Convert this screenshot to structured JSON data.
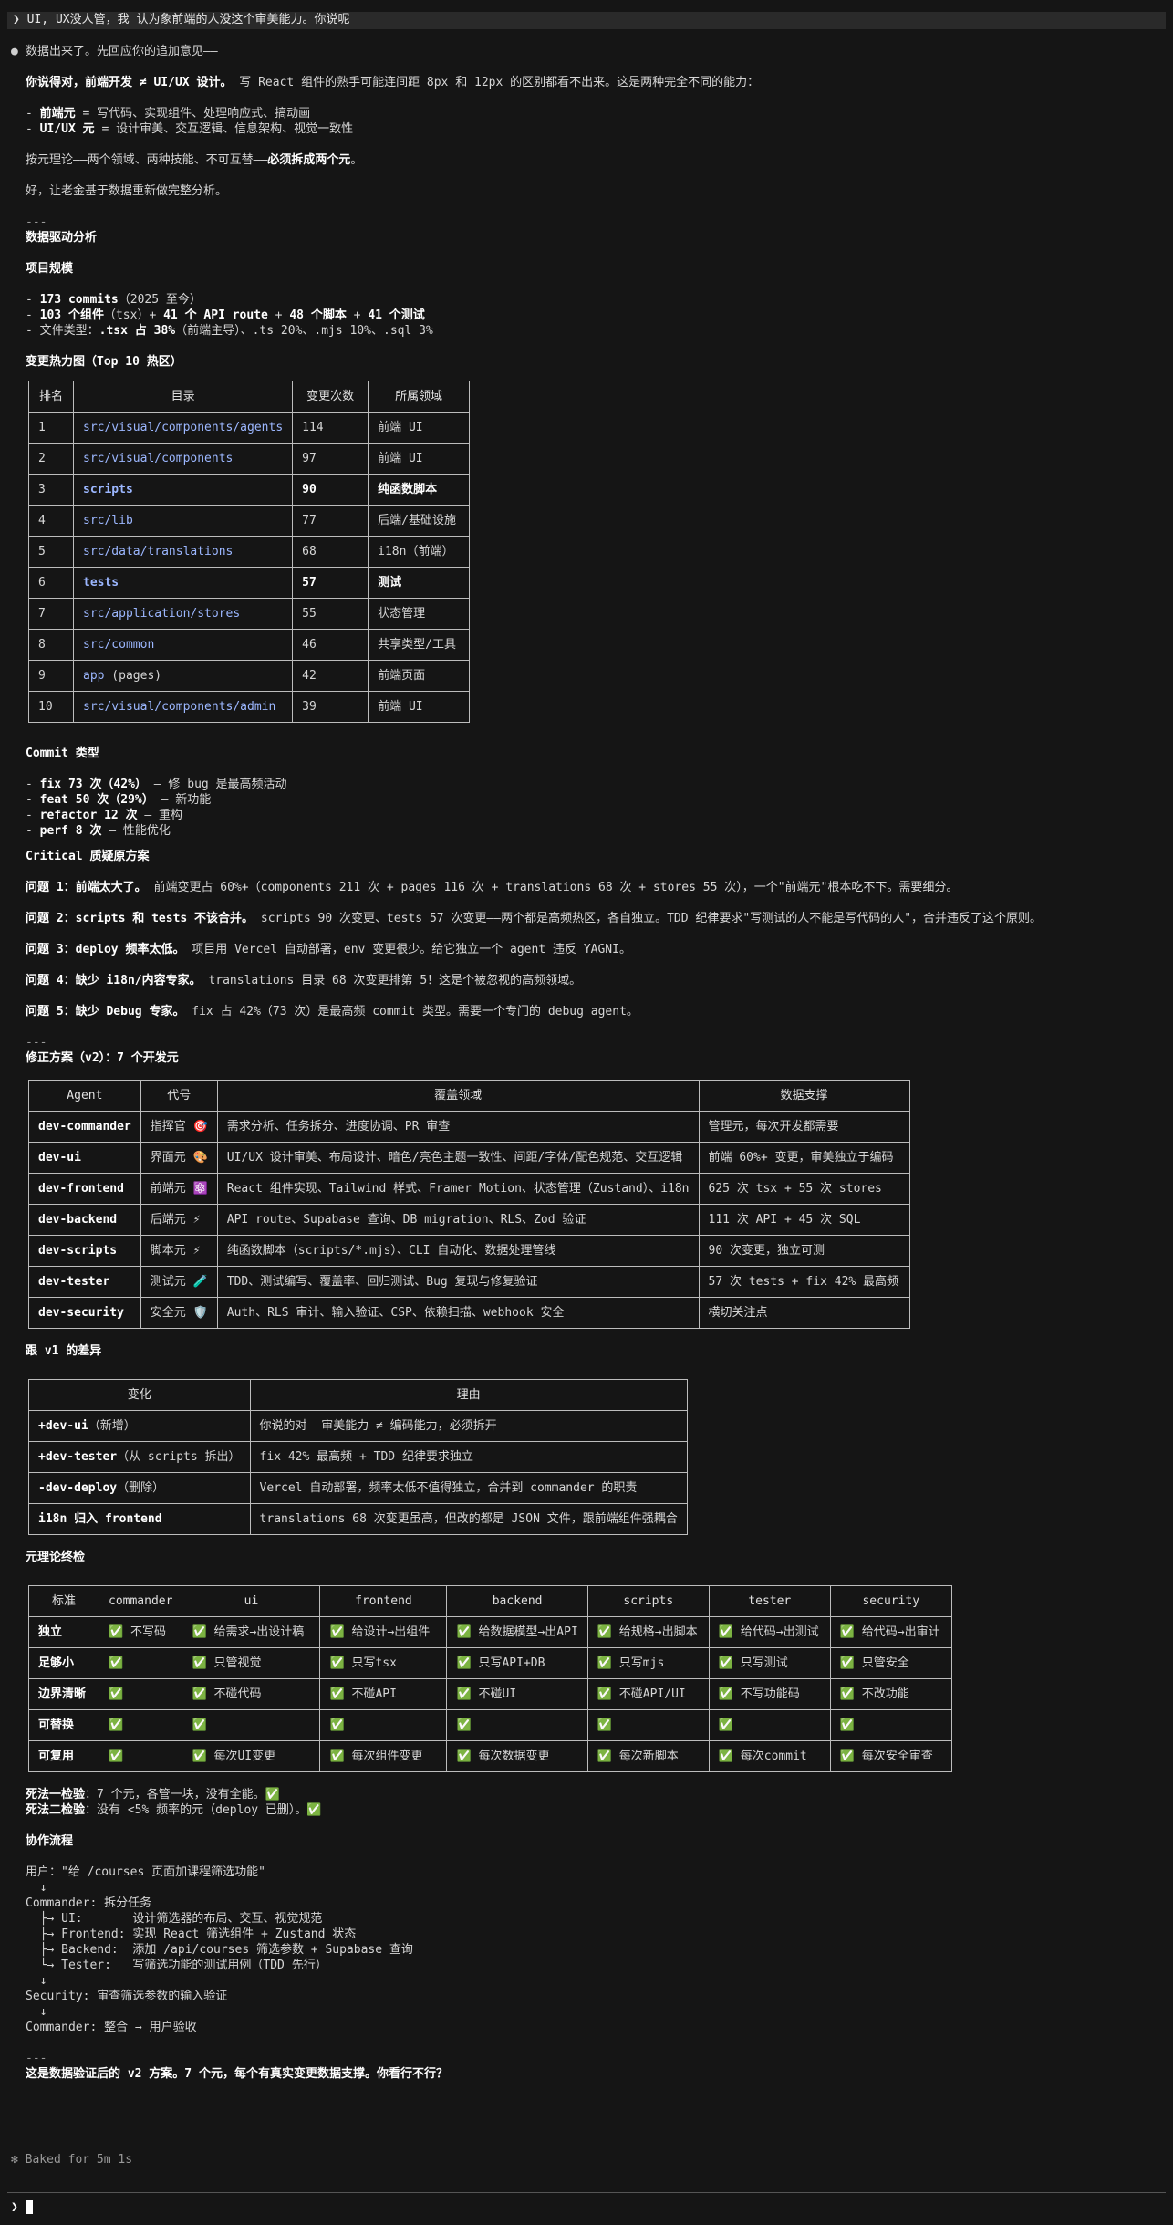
{
  "user_message": "UI, UX没人管，我 认为象前端的人没这个审美能力。你说呢",
  "response": {
    "intro": "数据出来了。先回应你的追加意见——",
    "claim_bold": "你说得对，前端开发 ≠ UI/UX 设计。",
    "claim_rest": "写 React 组件的熟手可能连间距 8px 和 12px 的区别都看不出来。这是两种完全不同的能力：",
    "roles": [
      {
        "name": "前端元",
        "desc": " = 写代码、实现组件、处理响应式、搞动画"
      },
      {
        "name": "UI/UX 元",
        "desc": " = 设计审美、交互逻辑、信息架构、视觉一致性"
      }
    ],
    "principle_a": "按元理论——两个领域、两种技能、不可互替——",
    "principle_b": "必须拆成两个元",
    "principle_c": "。",
    "transition": "好，让老金基于数据重新做完整分析。",
    "hr": "---",
    "section_data": "数据驱动分析",
    "section_scale": "项目规模",
    "scale": [
      {
        "pre": "- ",
        "b1": "173 commits",
        "post": "（2025 至今）"
      },
      {
        "pre": "- ",
        "b1": "103 个组件",
        "mid": "（tsx）+ ",
        "b2": "41 个 API route",
        "mid2": " + ",
        "b3": "48 个脚本",
        "mid3": " + ",
        "b4": "41 个测试"
      },
      {
        "pre": "- 文件类型：",
        "b1": ".tsx 占 38%",
        "post": "（前端主导）、.ts 20%、.mjs 10%、.sql 3%"
      }
    ],
    "heatmap_title": "变更热力图（Top 10 热区）",
    "heatmap_headers": [
      "排名",
      "目录",
      "变更次数",
      "所属领域"
    ],
    "heatmap_rows": [
      {
        "rank": "1",
        "dir": "src/visual/components/agents",
        "count": "114",
        "domain": "前端 UI",
        "bold": false
      },
      {
        "rank": "2",
        "dir": "src/visual/components",
        "count": "97",
        "domain": "前端 UI",
        "bold": false
      },
      {
        "rank": "3",
        "dir": "scripts",
        "count": "90",
        "domain": "纯函数脚本",
        "bold": true
      },
      {
        "rank": "4",
        "dir": "src/lib",
        "count": "77",
        "domain": "后端/基础设施",
        "bold": false
      },
      {
        "rank": "5",
        "dir": "src/data/translations",
        "count": "68",
        "domain": "i18n（前端）",
        "bold": false
      },
      {
        "rank": "6",
        "dir": "tests",
        "count": "57",
        "domain": "测试",
        "bold": true
      },
      {
        "rank": "7",
        "dir": "src/application/stores",
        "count": "55",
        "domain": "状态管理",
        "bold": false
      },
      {
        "rank": "8",
        "dir": "src/common",
        "count": "46",
        "domain": "共享类型/工具",
        "bold": false
      },
      {
        "rank": "9",
        "dir": "app",
        "dir_suffix": " (pages)",
        "count": "42",
        "domain": "前端页面",
        "bold": false
      },
      {
        "rank": "10",
        "dir": "src/visual/components/admin",
        "count": "39",
        "domain": "前端 UI",
        "bold": false
      }
    ],
    "commit_title": "Commit 类型",
    "commits": [
      {
        "b": "fix 73 次（42%）",
        "rest": " — 修 bug 是最高频活动"
      },
      {
        "b": "feat 50 次（29%）",
        "rest": " — 新功能"
      },
      {
        "b": "refactor 12 次",
        "rest": " — 重构"
      },
      {
        "b": "perf 8 次",
        "rest": " — 性能优化"
      }
    ],
    "critical_title": "Critical 质疑原方案",
    "issues": [
      {
        "b": "问题 1：前端太大了。",
        "rest": " 前端变更占 60%+（components 211 次 + pages 116 次 + translations 68 次 + stores 55 次），一个\"前端元\"根本吃不下。需要细分。"
      },
      {
        "b": "问题 2：scripts 和 tests 不该合并。",
        "rest": " scripts 90 次变更、tests 57 次变更——两个都是高频热区，各自独立。TDD 纪律要求\"写测试的人不能是写代码的人\"，合并违反了这个原则。"
      },
      {
        "b": "问题 3：deploy 频率太低。",
        "rest": " 项目用 Vercel 自动部署，env 变更很少。给它独立一个 agent 违反 YAGNI。"
      },
      {
        "b": "问题 4：缺少 i18n/内容专家。",
        "rest": " translations 目录 68 次变更排第 5！这是个被忽视的高频领域。"
      },
      {
        "b": "问题 5：缺少 Debug 专家。",
        "rest": " fix 占 42%（73 次）是最高频 commit 类型。需要一个专门的 debug agent。"
      }
    ],
    "v2_title": "修正方案（v2）：7 个开发元",
    "agents_headers": [
      "Agent",
      "代号",
      "覆盖领域",
      "数据支撑"
    ],
    "agents": [
      {
        "agent": "dev-commander",
        "code": "指挥官 🎯",
        "scope": "需求分析、任务拆分、进度协调、PR 审查",
        "data": "管理元，每次开发都需要"
      },
      {
        "agent": "dev-ui",
        "code": "界面元 🎨",
        "scope": "UI/UX 设计审美、布局设计、暗色/亮色主题一致性、间距/字体/配色规范、交互逻辑",
        "data": "前端 60%+ 变更，审美独立于编码"
      },
      {
        "agent": "dev-frontend",
        "code": "前端元 ⚛️",
        "scope": "React 组件实现、Tailwind 样式、Framer Motion、状态管理（Zustand）、i18n",
        "data": "625 次 tsx + 55 次 stores"
      },
      {
        "agent": "dev-backend",
        "code": "后端元 ⚡",
        "scope": "API route、Supabase 查询、DB migration、RLS、Zod 验证",
        "data": "111 次 API + 45 次 SQL"
      },
      {
        "agent": "dev-scripts",
        "code": "脚本元 ⚡",
        "scope": "纯函数脚本（scripts/*.mjs）、CLI 自动化、数据处理管线",
        "data": "90 次变更，独立可测"
      },
      {
        "agent": "dev-tester",
        "code": "测试元 🧪",
        "scope": "TDD、测试编写、覆盖率、回归测试、Bug 复现与修复验证",
        "data": "57 次 tests + fix 42% 最高频"
      },
      {
        "agent": "dev-security",
        "code": "安全元 🛡️",
        "scope": "Auth、RLS 审计、输入验证、CSP、依赖扫描、webhook 安全",
        "data": "横切关注点"
      }
    ],
    "diff_title": "跟 v1 的差异",
    "diff_headers": [
      "变化",
      "理由"
    ],
    "diffs": [
      {
        "b": "+dev-ui",
        "rest": "（新增）",
        "reason": "你说的对——审美能力 ≠ 编码能力，必须拆开"
      },
      {
        "b": "+dev-tester",
        "rest": "（从 scripts 拆出）",
        "reason": "fix 42% 最高频 + TDD 纪律要求独立"
      },
      {
        "b": "-dev-deploy",
        "rest": "（删除）",
        "reason": "Vercel 自动部署，频率太低不值得独立，合并到 commander 的职责"
      },
      {
        "b": "i18n 归入 frontend",
        "rest": "",
        "reason": "translations 68 次变更虽高，但改的都是 JSON 文件，跟前端组件强耦合"
      }
    ],
    "theory_title": "元理论终检",
    "theory_headers": [
      "标准",
      "commander",
      "ui",
      "frontend",
      "backend",
      "scripts",
      "tester",
      "security"
    ],
    "theory_rows": [
      {
        "label": "独立",
        "cells": [
          "✅ 不写码",
          "✅ 给需求→出设计稿",
          "✅ 给设计→出组件",
          "✅ 给数据模型→出API",
          "✅ 给规格→出脚本",
          "✅ 给代码→出测试",
          "✅ 给代码→出审计"
        ]
      },
      {
        "label": "足够小",
        "cells": [
          "✅",
          "✅ 只管视觉",
          "✅ 只写tsx",
          "✅ 只写API+DB",
          "✅ 只写mjs",
          "✅ 只写测试",
          "✅ 只管安全"
        ]
      },
      {
        "label": "边界清晰",
        "cells": [
          "✅",
          "✅ 不碰代码",
          "✅ 不碰API",
          "✅ 不碰UI",
          "✅ 不碰API/UI",
          "✅ 不写功能码",
          "✅ 不改功能"
        ]
      },
      {
        "label": "可替换",
        "cells": [
          "✅",
          "✅",
          "✅",
          "✅",
          "✅",
          "✅",
          "✅"
        ]
      },
      {
        "label": "可复用",
        "cells": [
          "✅",
          "✅ 每次UI变更",
          "✅ 每次组件变更",
          "✅ 每次数据变更",
          "✅ 每次新脚本",
          "✅ 每次commit",
          "✅ 每次安全审查"
        ]
      }
    ],
    "checks": [
      {
        "b": "死法一检验",
        "rest": "：7 个元，各管一块，没有全能。✅"
      },
      {
        "b": "死法二检验",
        "rest": "：没有 <5% 频率的元（deploy 已删）。✅"
      }
    ],
    "flow_title": "协作流程",
    "flow_lines": [
      "用户：\"给 /courses 页面加课程筛选功能\"",
      "  ↓",
      "Commander: 拆分任务",
      "  ├→ UI:       设计筛选器的布局、交互、视觉规范",
      "  ├→ Frontend: 实现 React 筛选组件 + Zustand 状态",
      "  ├→ Backend:  添加 /api/courses 筛选参数 + Supabase 查询",
      "  └→ Tester:   写筛选功能的测试用例（TDD 先行）",
      "  ↓",
      "Security: 审查筛选参数的输入验证",
      "  ↓",
      "Commander: 整合 → 用户验收"
    ],
    "closing": "这是数据验证后的 v2 方案。7 个元，每个有真实变更数据支撑。你看行不行？"
  },
  "footer": "✻ Baked for 5m 1s",
  "prompt_symbol": "❯"
}
